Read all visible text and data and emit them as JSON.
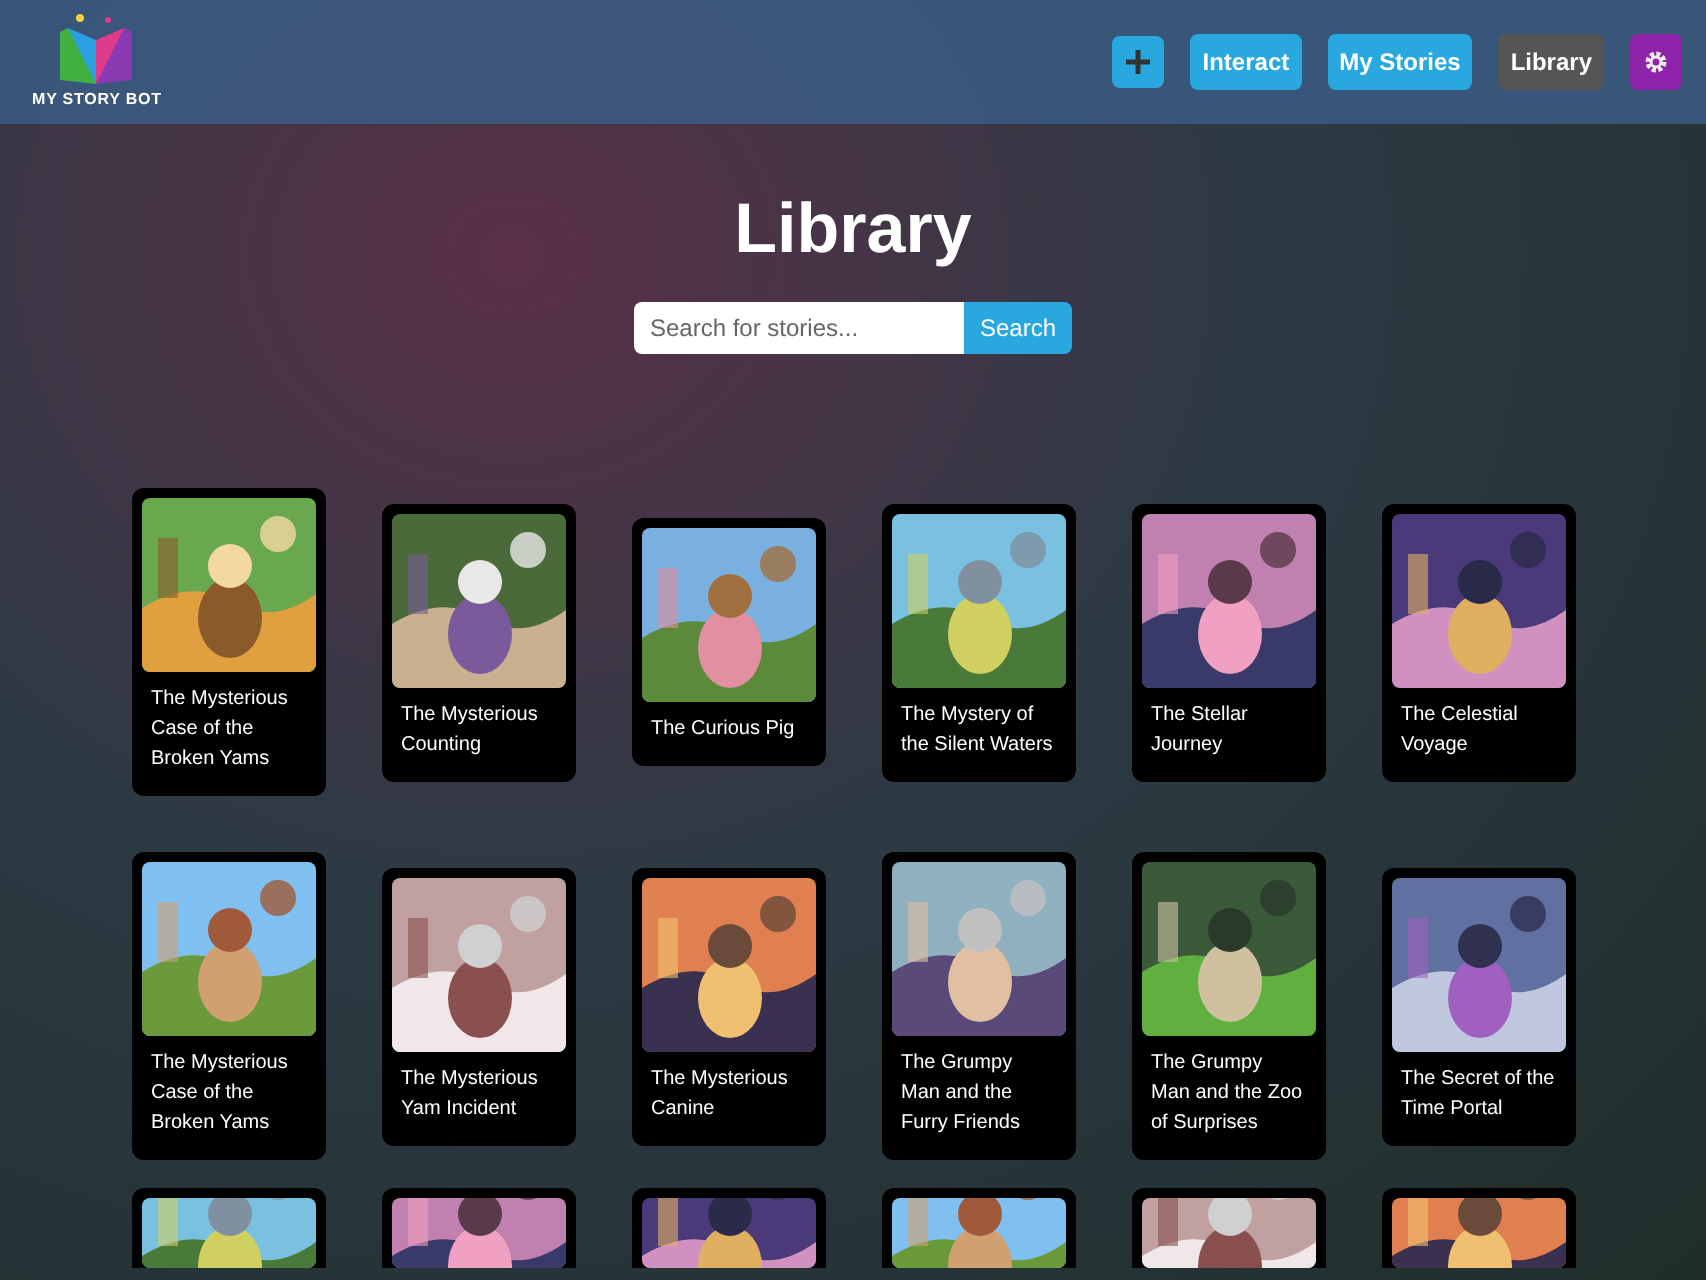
{
  "brand": {
    "name": "MY STORY BOT"
  },
  "nav": [
    {
      "kind": "plus",
      "selected": false
    },
    {
      "kind": "text",
      "label": "Interact",
      "selected": false
    },
    {
      "kind": "text",
      "label": "My Stories",
      "selected": false
    },
    {
      "kind": "text",
      "label": "Library",
      "selected": true
    },
    {
      "kind": "settings",
      "selected": false
    }
  ],
  "page_title": "Library",
  "search": {
    "placeholder": "Search for stories...",
    "button": "Search"
  },
  "stories": [
    {
      "title": "The Mysterious Case of the Broken Yams"
    },
    {
      "title": "The Mysterious Counting"
    },
    {
      "title": "The Curious Pig"
    },
    {
      "title": "The Mystery of the Silent Waters"
    },
    {
      "title": "The Stellar Journey"
    },
    {
      "title": "The Celestial Voyage"
    },
    {
      "title": "The Mysterious Case of the Broken Yams"
    },
    {
      "title": "The Mysterious Yam Incident"
    },
    {
      "title": "The Mysterious Canine"
    },
    {
      "title": "The Grumpy Man and the Furry Friends"
    },
    {
      "title": "The Grumpy Man and the Zoo of Surprises"
    },
    {
      "title": "The Secret of the Time Portal"
    },
    {
      "kind": "picture"
    },
    {
      "kind": "picture"
    },
    {
      "kind": "picture"
    },
    {
      "kind": "picture"
    },
    {
      "kind": "picture"
    },
    {
      "kind": "picture"
    }
  ]
}
